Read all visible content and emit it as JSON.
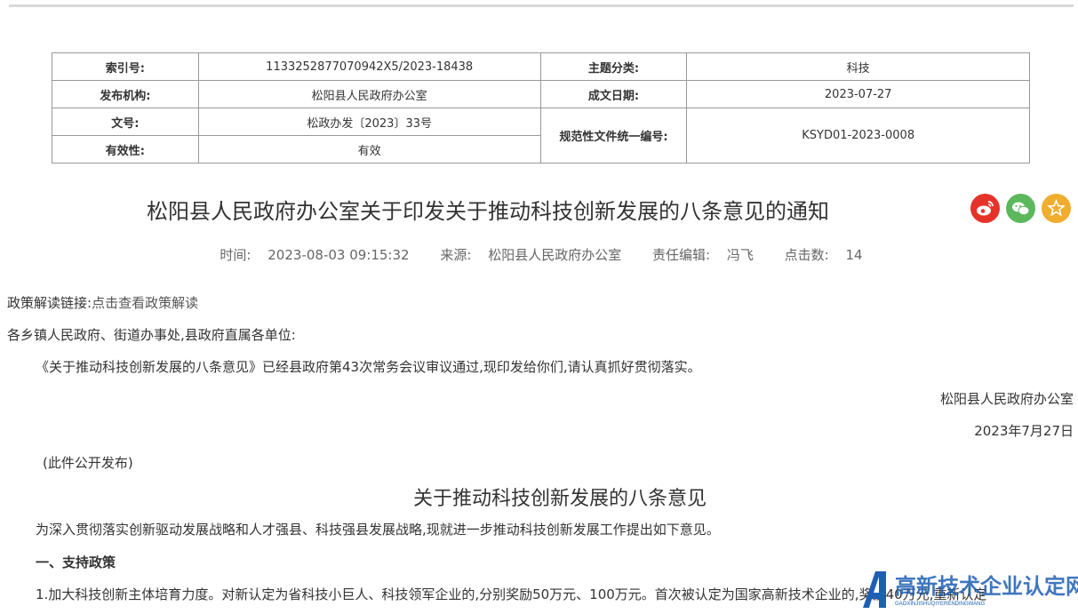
{
  "meta_table": {
    "index_label": "索引号:",
    "index_value": "113325287707094 2X5/2023-18438",
    "topic_label": "主题分类:",
    "topic_value": "科技",
    "publisher_label": "发布机构:",
    "publisher_value": "松阳县人民政府办公室",
    "date_label": "成文日期:",
    "date_value": "2023-07-27",
    "docno_label": "文号:",
    "docno_value": "松政办发〔2023〕33号",
    "code_label": "规范性文件统一编号:",
    "code_value": "KSYD01-2023-0008",
    "valid_label": "有效性:",
    "valid_value": "有效"
  },
  "article": {
    "title": "松阳县人民政府办公室关于印发关于推动科技创新发展的八条意见的通知",
    "time_label": "时间:",
    "time_value": "2023-08-03 09:15:32",
    "source_label": "来源:",
    "source_value": "松阳县人民政府办公室",
    "editor_label": "责任编辑:",
    "editor_value": "冯飞",
    "clicks_label": "点击数:",
    "clicks_value": "14"
  },
  "share": {
    "weibo_color": "#e6332a",
    "wechat_color": "#5cb85c",
    "favorite_color": "#f0ad2e"
  },
  "body": {
    "policy_link_label": "政策解读链接:",
    "policy_link_text": "点击查看政策解读",
    "addressee": "各乡镇人民政府、街道办事处,县政府直属各单位:",
    "para1": "《关于推动科技创新发展的八条意见》已经县政府第43次常务会议审议通过,现印发给你们,请认真抓好贯彻落实。",
    "signer": "松阳县人民政府办公室",
    "sign_date": "2023年7月27日",
    "public_note": "(此件公开发布)",
    "subtitle": "关于推动科技创新发展的八条意见",
    "para2": "为深入贯彻落实创新驱动发展战略和人才强县、科技强县发展战略,现就进一步推动科技创新发展工作提出如下意见。",
    "section1": "一、支持政策",
    "item1": "1.加大科技创新主体培育力度。对新认定为省科技小巨人、科技领军企业的,分别奖励50万元、100万元。首次被认定为国家高新技术企业的,奖励40万元,重新认定"
  },
  "watermark": {
    "text": "高新技术企业认定网",
    "sub": "GAOXINJISHUQIYERENDINGWANG",
    "color": "#1e5fb4"
  }
}
